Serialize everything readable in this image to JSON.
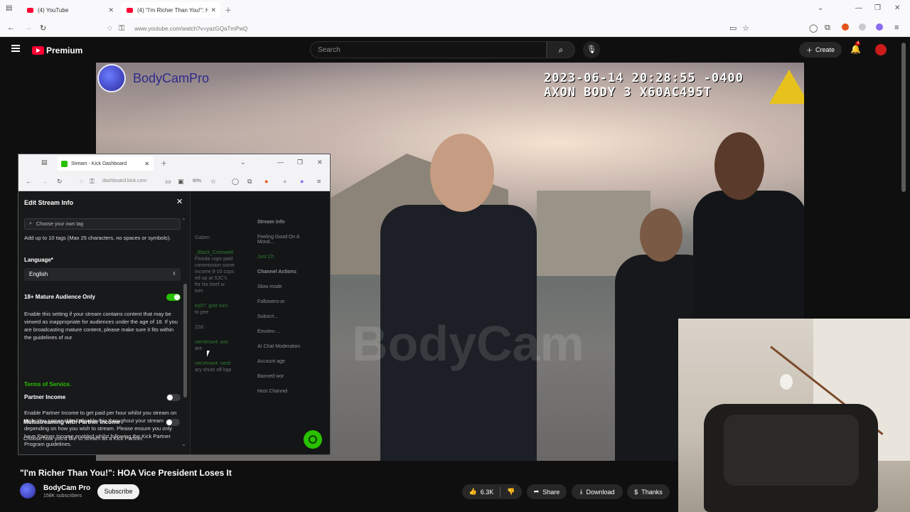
{
  "browser": {
    "tabs": [
      {
        "title": "(4) YouTube"
      },
      {
        "title": "(4) \"I'm Richer Than You!\": H"
      }
    ],
    "url": "www.youtube.com/watch?v=yazGQaTmPwQ"
  },
  "youtube": {
    "logo_text": "Premium",
    "search_placeholder": "Search",
    "create_label": "Create",
    "notifications_count": "4"
  },
  "video": {
    "channel_logo_text": "BodyCamPro",
    "timestamp_line1": "2023-06-14 20:28:55 -0400",
    "timestamp_line2": "AXON BODY 3 X60AC495T",
    "watermark": "BodyCam"
  },
  "kick_window": {
    "tab_title": "Stream - Kick Dashboard",
    "url": "dashboard.kick.com",
    "zoom": "90%",
    "dashboard_items": {
      "stream_info": "Stream info",
      "feeling": "Feeling Good On A Mond...",
      "channel_actions": "Channel Actions",
      "slow_mode": "Slow mode",
      "followers": "Followers-or",
      "subscribers": "Subscri...",
      "emotes": "Emotes-...",
      "ai_chat": "AI Chat Moderation",
      "account_age": "Account age",
      "banned_words": "Banned wor",
      "host_channel": "Host Channel",
      "chat_lines": [
        "_Black_Cromwell",
        "Florida cops paid",
        "commission some",
        "income 8-10 cops",
        "ed up at SJC's",
        "for his beef w",
        "tom",
        "ey07: gotz turn",
        "to pee",
        "22d:",
        "nerVerse4: wot",
        "are",
        "nerVerse4: nerd",
        "ary shuts off kpp",
        "Gaben",
        "Just Ch"
      ]
    },
    "modal": {
      "title": "Edit Stream Info",
      "tag_placeholder": "Choose your own tag",
      "tag_help": "Add up to 10 tags (Max 25 characters, no spaces or symbols).",
      "language_label": "Language*",
      "language_value": "English",
      "mature_label": "18+ Mature Audience Only",
      "mature_on": true,
      "mature_desc": "Enable this setting if your stream contains content that may be viewed as inappropriate for audiences under the age of 18. If you are broadcasting mature content, please make sure it fits within the guidelines of our",
      "tos_link": "Terms of Service.",
      "partner_label": "Partner Income",
      "partner_on": false,
      "partner_desc": "Enable Partner Income to get paid per hour whilst you stream on Kick. You can enable & disable this throughout your stream depending on how you wish to stream. Please ensure you only have Partner Income enabled whilst following the Kick Partner Program guidelines.",
      "multistream_label": "Multistreaming with Partner Income",
      "multistream_on": false,
      "choose_text": "Choose how you'd like to stream as a Kick Partner."
    }
  },
  "video_info": {
    "title": "\"I'm Richer Than You!\": HOA Vice President Loses It",
    "channel_name": "BodyCam Pro",
    "subscribers": "158K subscribers",
    "subscribe_label": "Subscribe",
    "likes": "6.3K",
    "share_label": "Share",
    "download_label": "Download",
    "thanks_label": "Thanks"
  },
  "colors": {
    "kick_green": "#29c000",
    "youtube_red": "#ff0033"
  }
}
